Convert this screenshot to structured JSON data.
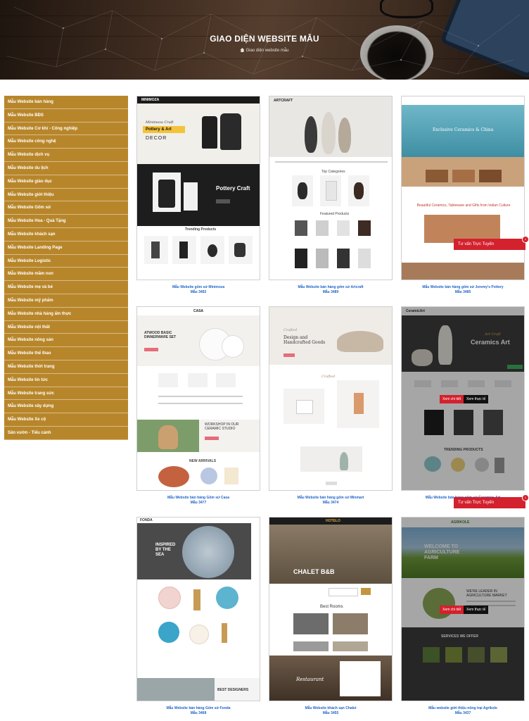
{
  "hero": {
    "title": "GIAO DIỆN WEBSITE MẪU",
    "breadcrumb": "Giao diện website mẫu"
  },
  "sidebar": {
    "items": [
      {
        "label": "Mẫu Website bán hàng"
      },
      {
        "label": "Mẫu Website BĐS"
      },
      {
        "label": "Mẫu Website Cơ khí - Công nghiệp"
      },
      {
        "label": "Mẫu Website công nghệ"
      },
      {
        "label": "Mẫu Website dịch vụ"
      },
      {
        "label": "Mẫu Website du lịch"
      },
      {
        "label": "Mẫu Website giáo dục"
      },
      {
        "label": "Mẫu Website giới thiệu"
      },
      {
        "label": "Mẫu Website Gốm sứ"
      },
      {
        "label": "Mẫu Website Hoa - Quà Tặng"
      },
      {
        "label": "Mẫu Website khách sạn"
      },
      {
        "label": "Mẫu Website Landing Page"
      },
      {
        "label": "Mẫu Website Logistic"
      },
      {
        "label": "Mẫu Website mầm non"
      },
      {
        "label": "Mẫu Website mẹ và bé"
      },
      {
        "label": "Mẫu Website mỹ phẩm"
      },
      {
        "label": "Mẫu Website nhà hàng ẩm thực"
      },
      {
        "label": "Mẫu Website nội thất"
      },
      {
        "label": "Mẫu Website nông sản"
      },
      {
        "label": "Mẫu Website thể thao"
      },
      {
        "label": "Mẫu Website thời trang"
      },
      {
        "label": "Mẫu Website tin tức"
      },
      {
        "label": "Mẫu Website trang sức"
      },
      {
        "label": "Mẫu Website xây dựng"
      },
      {
        "label": "Mẫu Website Xe cộ"
      },
      {
        "label": "Sân vườn - Tiểu cảnh"
      }
    ]
  },
  "cards": [
    {
      "title": "Mẫu Website gốm sứ Minimoza",
      "id": "Mẫu 3492",
      "thumb": {
        "brand": "MINIMOZA",
        "hero_script": "Minimoza Craft",
        "hero_label": "Pottery & Art",
        "hero_sub": "DECOR",
        "promo": "Pottery Craft",
        "section": "Trending Products"
      }
    },
    {
      "title": "Mẫu Website bán hàng gốm sứ Artcraft",
      "id": "Mẫu 3489",
      "thumb": {
        "brand": "ARTCRAFT",
        "sec1": "Top Categories",
        "sec2": "Featured Products"
      }
    },
    {
      "title": "Mẫu Website bán hàng gốm sứ Jeremy's Pottery",
      "id": "Mẫu 3485",
      "thumb": {
        "hero": "Exclusive Ceramics & China",
        "promo": "Beautiful Ceramics, Tableware and Gifts from Indian Culture"
      }
    },
    {
      "title": "Mẫu Website bán hàng Gốm sứ Casa",
      "id": "Mẫu 3477",
      "thumb": {
        "brand": "CASA",
        "hero": "ATWOOD BASIC DINNERWARE SET",
        "workshop": "WORKSHOP IN OUR CERAMIC STUDIO",
        "section": "NEW ARRIVALS"
      }
    },
    {
      "title": "Mẫu Website bán hàng gốm sứ Minmart",
      "id": "Mẫu 3474",
      "thumb": {
        "script": "Crafted",
        "hero": "Design and Handcrafted Goods",
        "section": "Crafted"
      }
    },
    {
      "title": "Mẫu Website bán hàng gốm sứ Ceramics Art",
      "id": "Mẫu 3470",
      "thumb": {
        "brand": "CeramicArt",
        "script": "Art Craft",
        "hero": "Ceramics Art",
        "section": "TRENDING PRODUCTS"
      }
    },
    {
      "title": "Mẫu Website bán hàng Gốm sứ Fonda",
      "id": "Mẫu 3468",
      "thumb": {
        "brand": "FONDA",
        "hero": "INSPIRED BY THE SEA",
        "banner": "BEST DESIGNERS"
      }
    },
    {
      "title": "Mẫu Website khách sạn Chalet",
      "id": "Mẫu 3455",
      "thumb": {
        "brand": "HOTELO",
        "hero": "CHALET B&B",
        "section": "Best Rooms",
        "footer": "Restaurant"
      }
    },
    {
      "title": "Mẫu website giới thiệu nông trại Agrikole",
      "id": "Mẫu 3437",
      "thumb": {
        "brand": "AGRIKOLE",
        "hero": "WELCOME TO AGRICULTURE FARM",
        "about": "WE'RE LEADER IN AGRICULTURE MARKET",
        "section": "SERVICES WE OFFER"
      }
    }
  ],
  "overlay_buttons": {
    "detail": "Xem chi tiết",
    "demo": "Xem thực tế"
  },
  "chat": {
    "label": "Tư vấn Trực Tuyến",
    "badge": "1"
  },
  "colors": {
    "sidebar": "#b8862a",
    "link": "#1e63c8",
    "accent": "#d3212d"
  }
}
